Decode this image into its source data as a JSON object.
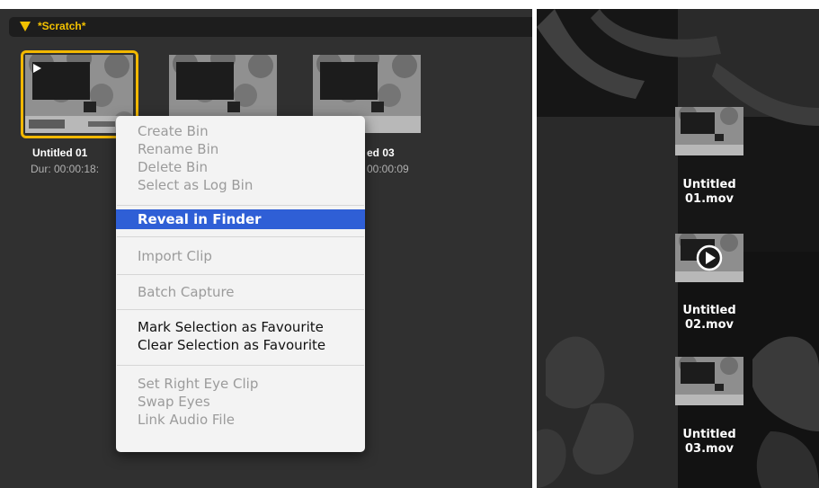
{
  "bin": {
    "title": "*Scratch*"
  },
  "clips": [
    {
      "name": "Untitled 01",
      "duration": "Dur: 00:00:18:",
      "selected": true
    },
    {
      "name": "ed 03",
      "duration": "00:00:09",
      "selected": false
    }
  ],
  "context_menu": {
    "items": [
      {
        "label": "Create Bin",
        "enabled": false
      },
      {
        "label": "Rename Bin",
        "enabled": false
      },
      {
        "label": "Delete Bin",
        "enabled": false
      },
      {
        "label": "Select as Log Bin",
        "enabled": false
      },
      {
        "label": "Reveal in Finder",
        "enabled": true,
        "highlighted": true
      },
      {
        "label": "Import Clip",
        "enabled": false
      },
      {
        "label": "Batch Capture",
        "enabled": false
      },
      {
        "label": "Mark Selection as Favourite",
        "enabled": true
      },
      {
        "label": "Clear Selection as Favourite",
        "enabled": true
      },
      {
        "label": "Set Right Eye Clip",
        "enabled": false
      },
      {
        "label": "Swap Eyes",
        "enabled": false
      },
      {
        "label": "Link Audio File",
        "enabled": false
      }
    ]
  },
  "right_clips": [
    {
      "name_line1": "Untitled",
      "name_line2": "01.mov",
      "playing": false
    },
    {
      "name_line1": "Untitled",
      "name_line2": "02.mov",
      "playing": true
    },
    {
      "name_line1": "Untitled",
      "name_line2": "03.mov",
      "playing": false
    }
  ],
  "colors": {
    "accent": "#f2c100",
    "menu_highlight": "#2f5fd6",
    "panel_bg": "#303030"
  }
}
